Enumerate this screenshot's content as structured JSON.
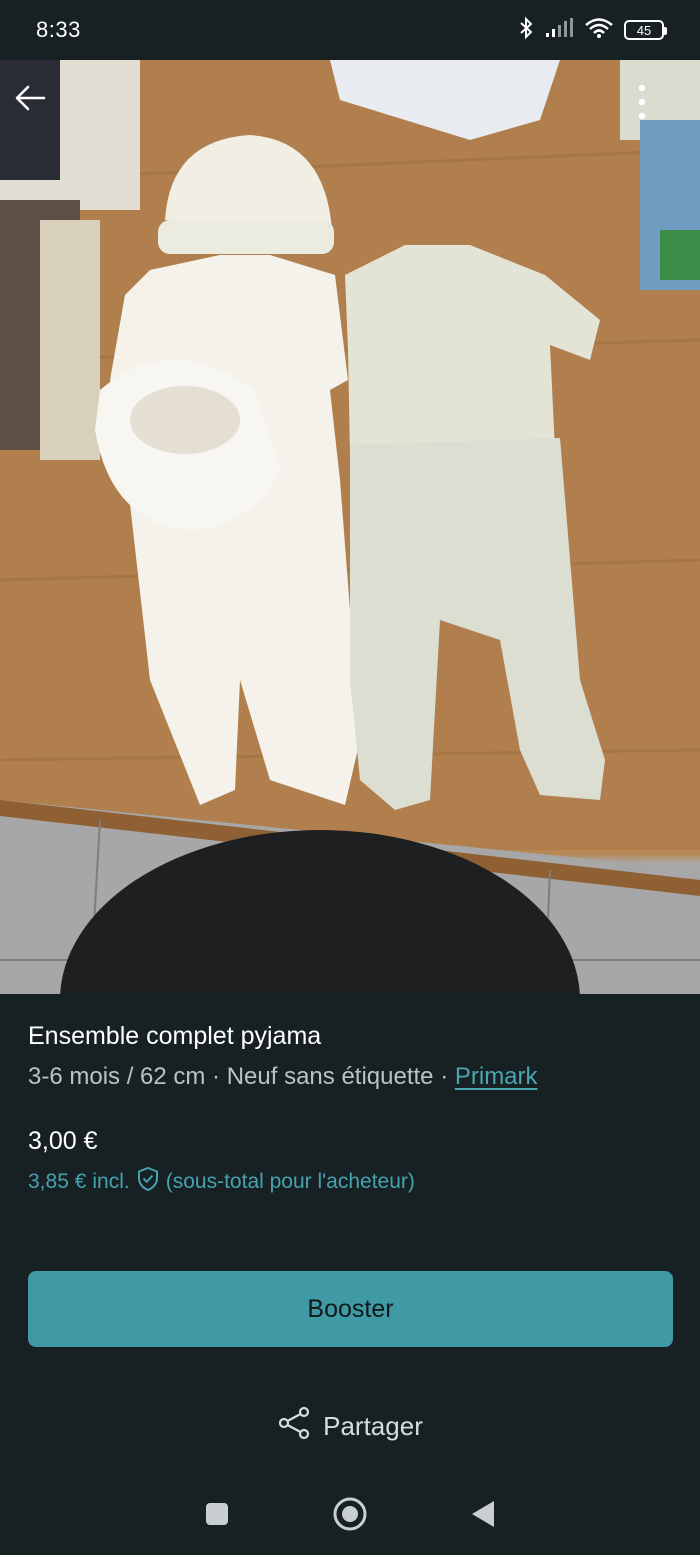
{
  "status_bar": {
    "time": "8:33",
    "battery": "45",
    "icons": [
      "bluetooth-icon",
      "signal-icon",
      "wifi-icon",
      "battery-icon"
    ]
  },
  "photo": {
    "description_icons": [
      "back-arrow-icon",
      "more-vertical-icon"
    ]
  },
  "listing": {
    "title": "Ensemble complet pyjama",
    "size": "3-6 mois / 62 cm",
    "separator1": " · ",
    "condition": "Neuf sans étiquette",
    "separator2": " · ",
    "brand": "Primark",
    "price": "3,00 €",
    "total_price": "3,85 €",
    "total_incl": "incl.",
    "total_note": "(sous-total pour l'acheteur)"
  },
  "actions": {
    "booster_label": "Booster",
    "share_label": "Partager"
  },
  "colors": {
    "accent": "#3f9aa5",
    "link": "#4aa6b1",
    "background": "#172023"
  }
}
